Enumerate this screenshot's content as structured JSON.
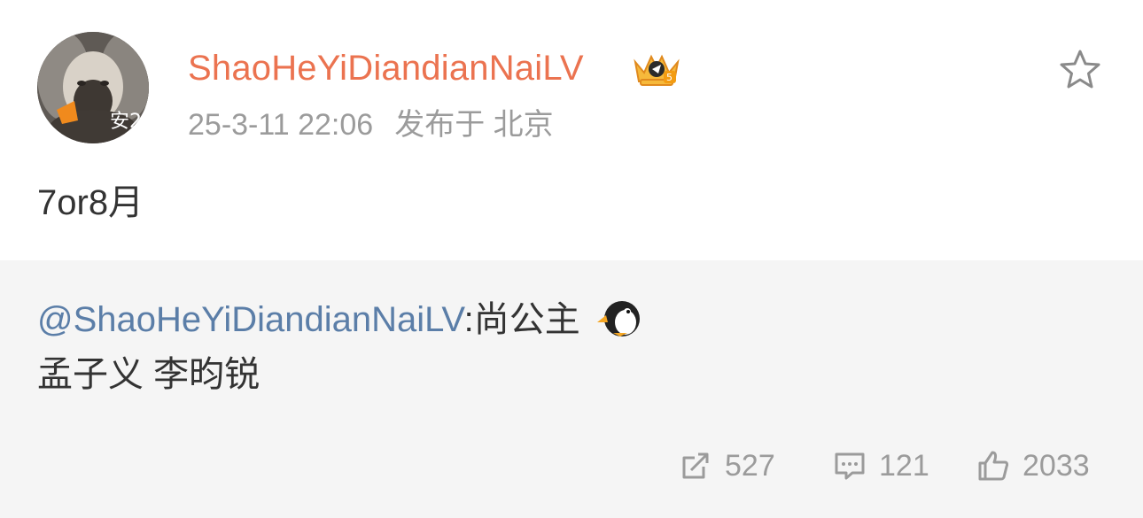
{
  "post": {
    "author": "ShaoHeYiDiandianNaiLV",
    "avatar_badge": "安2",
    "timestamp": "25-3-11 22:06",
    "location": "发布于 北京",
    "content": "7or8月",
    "icons": {
      "crown": "crown-badge-icon",
      "favorite": "star-icon"
    }
  },
  "quoted": {
    "mention": "@ShaoHeYiDiandianNaiLV",
    "text": ":尚公主",
    "emoji": "penguin-icon",
    "line2": "孟子义 李昀锐"
  },
  "actions": {
    "repost_count": "527",
    "comment_count": "121",
    "like_count": "2033"
  },
  "colors": {
    "username": "#eb7350",
    "mention": "#5b7ea8",
    "meta": "#9b9b9b",
    "quote_bg": "#f5f5f5"
  }
}
